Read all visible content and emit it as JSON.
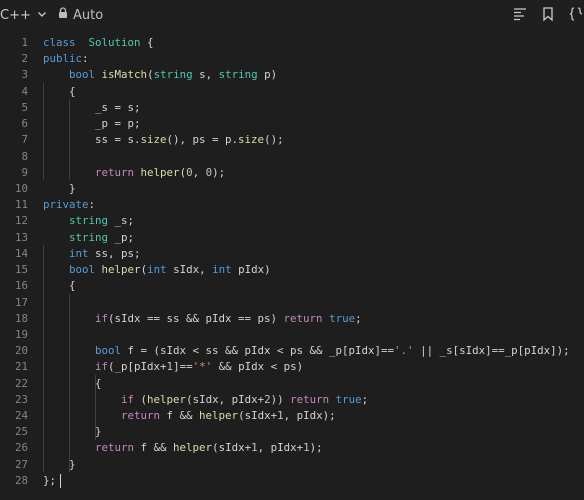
{
  "toolbar": {
    "language": "C++",
    "mode": "Auto"
  },
  "icons": {
    "chevron": "chevron-down-icon",
    "lock": "lock-icon",
    "format": "format-icon",
    "bookmark": "bookmark-icon",
    "braces": "braces-icon"
  },
  "colors": {
    "background": "#1e1e1e",
    "keyword": "#569cd6",
    "control": "#c586c0",
    "type": "#4ec9b0",
    "function": "#dcdcaa",
    "number": "#b5cea8",
    "string": "#ce9178",
    "text": "#d4d4d4",
    "line_number": "#858585"
  },
  "code": [
    [
      [
        "kw",
        "class"
      ],
      [
        "",
        "  "
      ],
      [
        "ty",
        "Solution"
      ],
      [
        "",
        " {"
      ]
    ],
    [
      [
        "kw",
        "public"
      ],
      [
        "",
        ":"
      ]
    ],
    [
      [
        "",
        "    "
      ],
      [
        "kw",
        "bool"
      ],
      [
        "",
        " "
      ],
      [
        "fn",
        "isMatch"
      ],
      [
        "",
        "("
      ],
      [
        "ty",
        "string"
      ],
      [
        "",
        " s, "
      ],
      [
        "ty",
        "string"
      ],
      [
        "",
        " p)"
      ]
    ],
    [
      [
        "",
        "    {"
      ]
    ],
    [
      [
        "",
        "        _s = s;"
      ]
    ],
    [
      [
        "",
        "        _p = p;"
      ]
    ],
    [
      [
        "",
        "        ss = s."
      ],
      [
        "fn",
        "size"
      ],
      [
        "",
        "(), ps = p."
      ],
      [
        "fn",
        "size"
      ],
      [
        "",
        "();"
      ]
    ],
    [
      [
        "",
        ""
      ]
    ],
    [
      [
        "",
        "        "
      ],
      [
        "ctl",
        "return"
      ],
      [
        "",
        " "
      ],
      [
        "fn",
        "helper"
      ],
      [
        "",
        "("
      ],
      [
        "num",
        "0"
      ],
      [
        "",
        ", "
      ],
      [
        "num",
        "0"
      ],
      [
        "",
        ");"
      ]
    ],
    [
      [
        "",
        "    }"
      ]
    ],
    [
      [
        "kw",
        "private"
      ],
      [
        "",
        ":"
      ]
    ],
    [
      [
        "",
        "    "
      ],
      [
        "ty",
        "string"
      ],
      [
        "",
        " _s;"
      ]
    ],
    [
      [
        "",
        "    "
      ],
      [
        "ty",
        "string"
      ],
      [
        "",
        " _p;"
      ]
    ],
    [
      [
        "",
        "    "
      ],
      [
        "kw",
        "int"
      ],
      [
        "",
        " ss, ps;"
      ]
    ],
    [
      [
        "",
        "    "
      ],
      [
        "kw",
        "bool"
      ],
      [
        "",
        " "
      ],
      [
        "fn",
        "helper"
      ],
      [
        "",
        "("
      ],
      [
        "kw",
        "int"
      ],
      [
        "",
        " sIdx, "
      ],
      [
        "kw",
        "int"
      ],
      [
        "",
        " pIdx)"
      ]
    ],
    [
      [
        "",
        "    {"
      ]
    ],
    [
      [
        "",
        ""
      ]
    ],
    [
      [
        "",
        "        "
      ],
      [
        "ctl",
        "if"
      ],
      [
        "",
        "(sIdx == ss && pIdx == ps) "
      ],
      [
        "ctl",
        "return"
      ],
      [
        "",
        " "
      ],
      [
        "kw",
        "true"
      ],
      [
        "",
        ";"
      ]
    ],
    [
      [
        "",
        ""
      ]
    ],
    [
      [
        "",
        "        "
      ],
      [
        "kw",
        "bool"
      ],
      [
        "",
        " f = (sIdx < ss && pIdx < ps && _p[pIdx]=="
      ],
      [
        "str",
        "'.'"
      ],
      [
        "",
        " || _s[sIdx]==_p[pIdx]);"
      ]
    ],
    [
      [
        "",
        "        "
      ],
      [
        "ctl",
        "if"
      ],
      [
        "",
        "(_p[pIdx+"
      ],
      [
        "num",
        "1"
      ],
      [
        "",
        "]=="
      ],
      [
        "str",
        "'*'"
      ],
      [
        "",
        " && pIdx < ps)"
      ]
    ],
    [
      [
        "",
        "        {"
      ]
    ],
    [
      [
        "",
        "            "
      ],
      [
        "ctl",
        "if"
      ],
      [
        "",
        " ("
      ],
      [
        "fn",
        "helper"
      ],
      [
        "",
        "(sIdx, pIdx+"
      ],
      [
        "num",
        "2"
      ],
      [
        "",
        "))"
      ],
      [
        "",
        ""
      ],
      [
        "",
        ""
      ],
      [
        "",
        " "
      ],
      [
        "ctl",
        "return"
      ],
      [
        "",
        " "
      ],
      [
        "kw",
        "true"
      ],
      [
        "",
        ";"
      ]
    ],
    [
      [
        "",
        "            "
      ],
      [
        "ctl",
        "return"
      ],
      [
        "",
        " f && "
      ],
      [
        "fn",
        "helper"
      ],
      [
        "",
        "(sIdx+"
      ],
      [
        "num",
        "1"
      ],
      [
        "",
        ", pIdx);"
      ]
    ],
    [
      [
        "",
        "        }"
      ]
    ],
    [
      [
        "",
        "        "
      ],
      [
        "ctl",
        "return"
      ],
      [
        "",
        " f && "
      ],
      [
        "fn",
        "helper"
      ],
      [
        "",
        "(sIdx+"
      ],
      [
        "num",
        "1"
      ],
      [
        "",
        ", pIdx+"
      ],
      [
        "num",
        "1"
      ],
      [
        "",
        ");"
      ]
    ],
    [
      [
        "",
        "    }"
      ]
    ],
    [
      [
        "",
        "};"
      ]
    ]
  ]
}
